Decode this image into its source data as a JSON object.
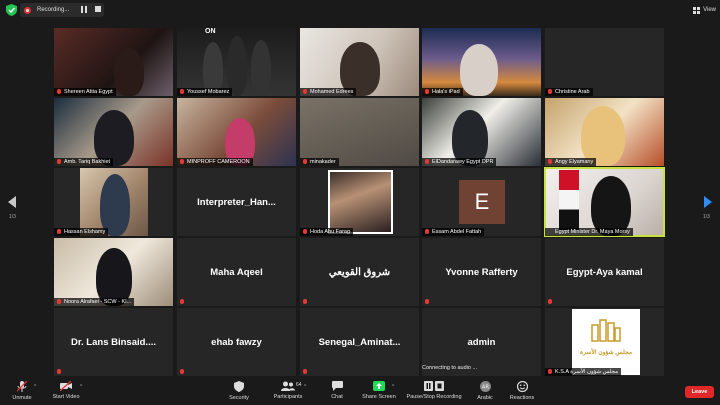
{
  "topbar": {
    "recording_label": "Recording...",
    "view_label": "View"
  },
  "pagination": {
    "left": "1/3",
    "right": "1/3"
  },
  "tiles": [
    {
      "name": "Shereen Attia Egypt",
      "muted": true
    },
    {
      "name": "Youssef Mobarez",
      "muted": true,
      "overlay": "ON"
    },
    {
      "name": "Mohamed Edrees",
      "muted": true
    },
    {
      "name": "Hala's iPad",
      "muted": true
    },
    {
      "name": "Christine Arab",
      "muted": true
    },
    {
      "name": "Amb. Tariq Bakhiet",
      "muted": true
    },
    {
      "name": "MINPROFF CAMEROON",
      "muted": true
    },
    {
      "name": "minakader",
      "muted": true
    },
    {
      "name": "ElDandarawy Egypt DPR",
      "muted": true
    },
    {
      "name": "Angy Elyamany",
      "muted": true
    },
    {
      "name": "Hassan Elshamy",
      "muted": true
    },
    {
      "name": "Interpreter_Han...",
      "muted": false
    },
    {
      "name": "Hoda Abu Farag",
      "muted": true
    },
    {
      "name": "Essam Abdel Fattah",
      "muted": true,
      "initial": "E"
    },
    {
      "name": "Egypt Minister Dr. Maya Morsy",
      "muted": false
    },
    {
      "name": "Noora Alrafaei - SCW - KI...",
      "muted": true
    },
    {
      "name": "Maha Aqeel",
      "muted": true
    },
    {
      "name": "شروق القويعي",
      "muted": true
    },
    {
      "name": "Yvonne Rafferty",
      "muted": true
    },
    {
      "name": "Egypt-Aya kamal",
      "muted": true
    },
    {
      "name": "Dr. Lans Binsaid....",
      "muted": true
    },
    {
      "name": "ehab fawzy",
      "muted": true
    },
    {
      "name": "Senegal_Aminat...",
      "muted": true
    },
    {
      "name": "admin",
      "muted": false
    },
    {
      "name": "K.S.A مجلس شؤون الأسرة",
      "muted": true,
      "logo_text": "مجلس شؤون الأسرة"
    }
  ],
  "status": {
    "connecting": "Connecting to audio ..."
  },
  "toolbar": {
    "unmute": "Unmute",
    "start_video": "Start Video",
    "security": "Security",
    "participants": "Participants",
    "participants_count": "64",
    "chat": "Chat",
    "share_screen": "Share Screen",
    "pause_stop_recording": "Pause/Stop Recording",
    "arabic": "Arabic",
    "reactions": "Reactions",
    "leave": "Leave"
  },
  "colors": {
    "background": "#1a1a1a",
    "tile": "#262626",
    "active_speaker": "#c7e23a",
    "muted": "#e53935",
    "share": "#23d959",
    "leave": "#e02828",
    "accent": "#2d8cff"
  }
}
